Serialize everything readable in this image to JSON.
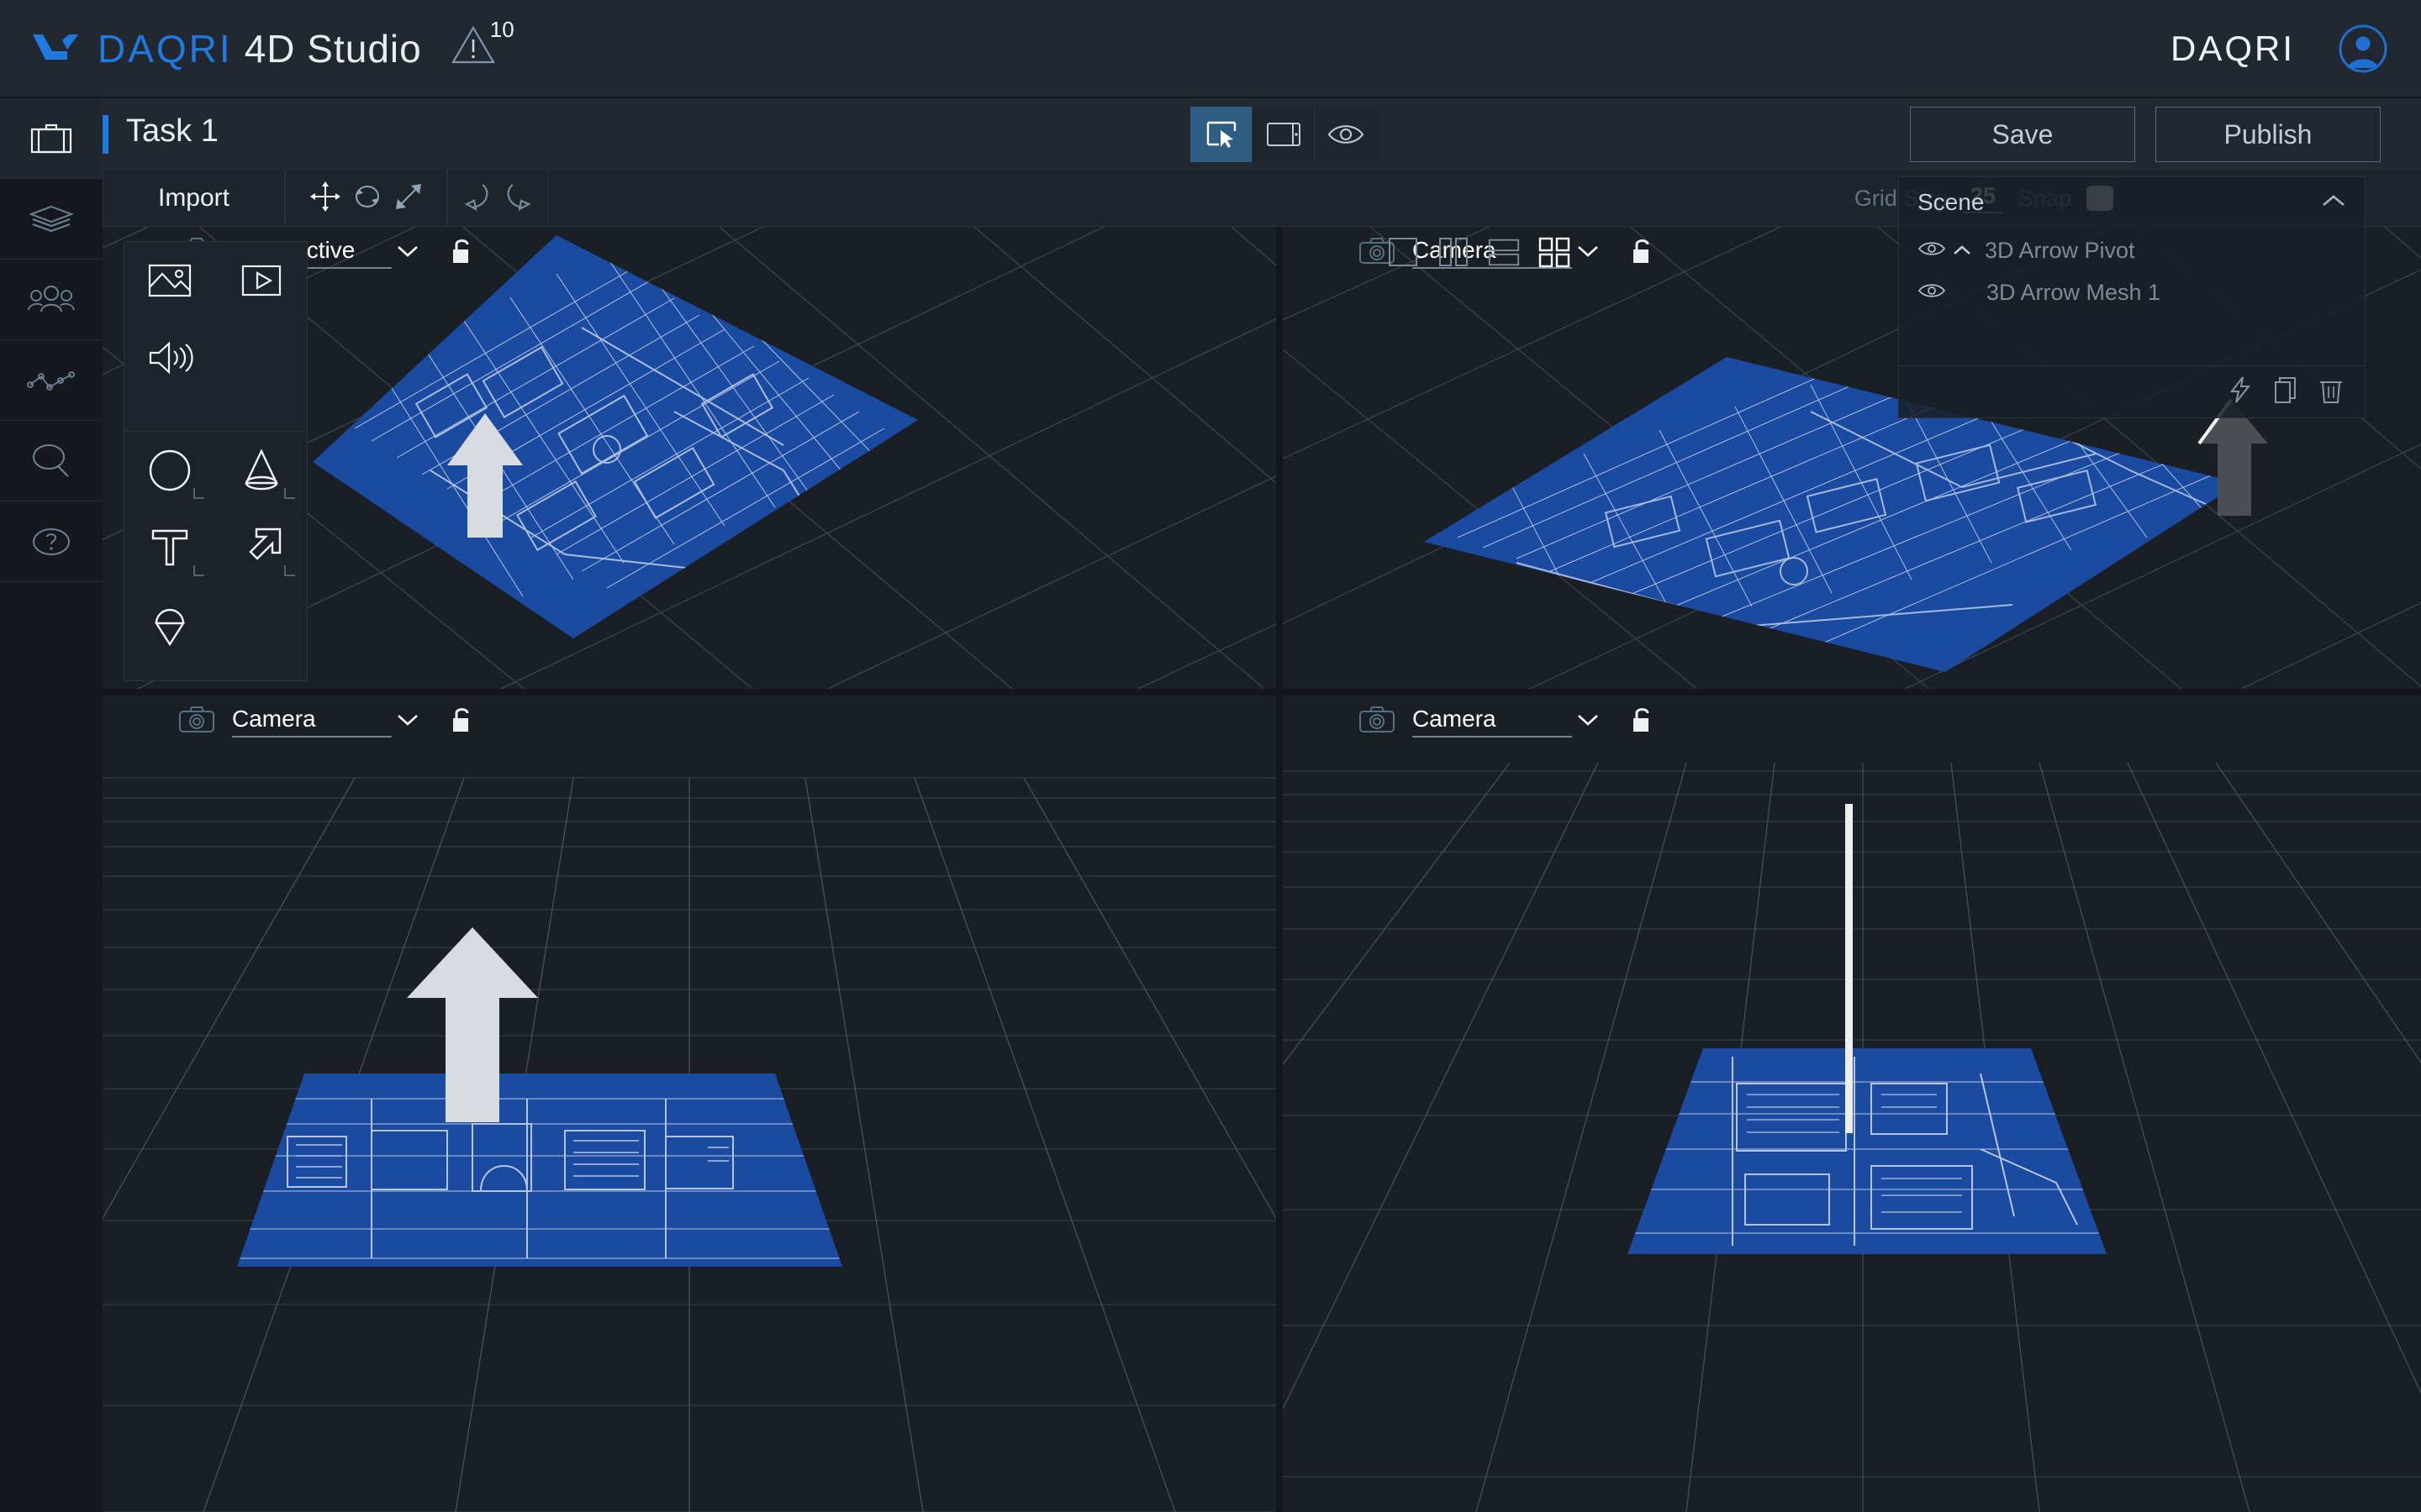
{
  "header": {
    "brand_primary": "DAQRI",
    "brand_secondary": "4D Studio",
    "brand_right": "DAQRI",
    "warning_count": "10",
    "logo_icon": "daqri-logo-icon",
    "warning_icon": "warning-triangle-icon",
    "avatar_icon": "user-avatar-icon",
    "accent_color": "#1f79e0"
  },
  "sidebar": {
    "items": [
      {
        "name": "sidebar-item-projects",
        "icon": "briefcase-icon",
        "active": true
      },
      {
        "name": "sidebar-item-layers",
        "icon": "layers-icon",
        "active": false
      },
      {
        "name": "sidebar-item-team",
        "icon": "people-group-icon",
        "active": false
      },
      {
        "name": "sidebar-item-analytics",
        "icon": "line-chart-icon",
        "active": false
      },
      {
        "name": "sidebar-item-search",
        "icon": "search-magnifier-icon",
        "active": false
      },
      {
        "name": "sidebar-item-help",
        "icon": "help-question-icon",
        "active": false
      }
    ]
  },
  "taskbar": {
    "title": "Task 1",
    "modes": [
      {
        "name": "mode-edit",
        "icon": "select-cursor-icon",
        "active": true
      },
      {
        "name": "mode-device-preview",
        "icon": "tablet-device-icon",
        "active": false
      },
      {
        "name": "mode-preview",
        "icon": "eye-preview-icon",
        "active": false
      }
    ],
    "save_label": "Save",
    "publish_label": "Publish"
  },
  "toolbar": {
    "import_label": "Import",
    "transform_tools": [
      {
        "name": "tool-move",
        "icon": "move-arrows-icon",
        "active": true
      },
      {
        "name": "tool-rotate",
        "icon": "rotate-icon",
        "active": false
      },
      {
        "name": "tool-scale",
        "icon": "scale-diagonal-icon",
        "active": false
      }
    ],
    "history_tools": [
      {
        "name": "undo-button",
        "icon": "undo-arrow-icon"
      },
      {
        "name": "redo-button",
        "icon": "redo-arrow-icon"
      }
    ],
    "grid_size_label": "Grid Size",
    "grid_size_value": "25",
    "snap_label": "Snap",
    "snap_enabled": true
  },
  "import_panel": {
    "media_items": [
      {
        "name": "import-image",
        "icon": "image-picture-icon"
      },
      {
        "name": "import-video",
        "icon": "video-play-icon"
      },
      {
        "name": "import-audio",
        "icon": "audio-speaker-icon"
      }
    ],
    "primitive_items": [
      {
        "name": "add-sphere",
        "icon": "circle-sphere-icon",
        "expandable": true
      },
      {
        "name": "add-cone",
        "icon": "cone-icon",
        "expandable": true
      },
      {
        "name": "add-text",
        "icon": "text-t-icon",
        "expandable": true
      },
      {
        "name": "add-arrow",
        "icon": "arrow-3d-icon",
        "expandable": true
      },
      {
        "name": "add-marker",
        "icon": "map-pin-icon",
        "expandable": false
      }
    ]
  },
  "viewports": [
    {
      "name": "viewport-top-left",
      "camera_label": "Perspective",
      "camera_icon": "camera-icon",
      "lock_icon": "unlocked-padlock-icon",
      "chevron_icon": "chevron-down-icon",
      "view": "perspective-iso",
      "show_layout_buttons": false
    },
    {
      "name": "viewport-top-right",
      "camera_label": "Camera",
      "camera_icon": "camera-icon",
      "lock_icon": "unlocked-padlock-icon",
      "chevron_icon": "chevron-down-icon",
      "view": "iso-shadowed",
      "show_layout_buttons": true
    },
    {
      "name": "viewport-bottom-left",
      "camera_label": "Camera",
      "camera_icon": "camera-icon",
      "lock_icon": "unlocked-padlock-icon",
      "chevron_icon": "chevron-down-icon",
      "view": "front",
      "show_layout_buttons": false
    },
    {
      "name": "viewport-bottom-right",
      "camera_label": "Camera",
      "camera_icon": "camera-icon",
      "lock_icon": "unlocked-padlock-icon",
      "chevron_icon": "chevron-down-icon",
      "view": "side",
      "show_layout_buttons": false
    }
  ],
  "layout_buttons": [
    {
      "name": "layout-single",
      "icon": "layout-single-icon",
      "active": false
    },
    {
      "name": "layout-two-columns",
      "icon": "layout-two-columns-icon",
      "active": false
    },
    {
      "name": "layout-two-rows",
      "icon": "layout-two-rows-icon",
      "active": false
    },
    {
      "name": "layout-quad",
      "icon": "layout-quad-icon",
      "active": true
    }
  ],
  "scene_panel": {
    "title": "Scene",
    "collapse_icon": "chevron-up-icon",
    "items": [
      {
        "name": "scene-item-arrow-pivot",
        "label": "3D Arrow Pivot",
        "eye_icon": "eye-visible-icon",
        "twisty_icon": "chevron-up-icon",
        "child": false
      },
      {
        "name": "scene-item-arrow-mesh",
        "label": "3D Arrow Mesh 1",
        "eye_icon": "eye-visible-icon",
        "twisty_icon": "",
        "child": true
      }
    ],
    "footer_actions": [
      {
        "name": "scene-action-trigger",
        "icon": "lightning-bolt-icon"
      },
      {
        "name": "scene-action-duplicate",
        "icon": "duplicate-copy-icon"
      },
      {
        "name": "scene-action-delete",
        "icon": "trash-delete-icon"
      }
    ]
  },
  "colors": {
    "blueprint_blue": "#1b4ba0",
    "panel_bg": "#1e242b",
    "header_bg": "#22282f",
    "sidebar_bg": "#15191f",
    "viewport_bg": "#1a1f25",
    "accent_blue": "#1f79e0",
    "active_tab_blue": "#2f5e85",
    "arrow_light": "#d8dce0",
    "arrow_dark": "#4b4f53"
  }
}
